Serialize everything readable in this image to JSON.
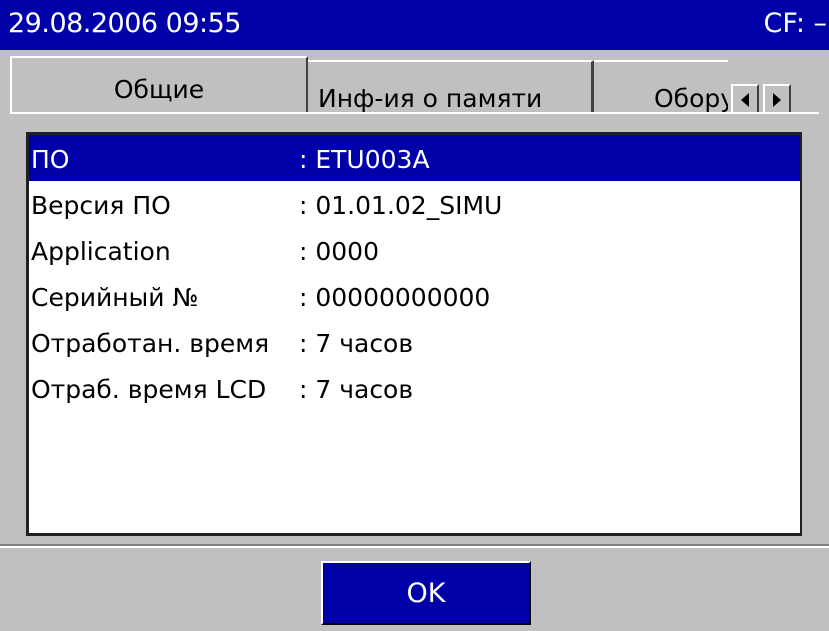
{
  "titlebar": {
    "datetime": "29.08.2006 09:55",
    "cf_status": "CF: –"
  },
  "tabs": [
    {
      "label": "Общие",
      "active": true
    },
    {
      "label": "Инф-ия о памяти",
      "active": false
    },
    {
      "label": "Обору",
      "active": false
    }
  ],
  "tab_scroll": {
    "left_icon": "triangle-left-icon",
    "right_icon": "triangle-right-icon"
  },
  "info_rows": [
    {
      "label": "ПО",
      "value": ": ETU003A",
      "selected": true
    },
    {
      "label": "Версия ПО",
      "value": ": 01.01.02_SIMU",
      "selected": false
    },
    {
      "label": "Application",
      "value": ": 0000",
      "selected": false
    },
    {
      "label": "Серийный №",
      "value": ": 00000000000",
      "selected": false
    },
    {
      "label": "Отработан. время",
      "value": ": 7 часов",
      "selected": false
    },
    {
      "label": "Отраб. время LCD",
      "value": ": 7 часов",
      "selected": false
    }
  ],
  "buttons": {
    "ok_label": "OK"
  },
  "colors": {
    "accent": "#0000a8",
    "background": "#c0c0c0",
    "list_background": "#ffffff"
  }
}
